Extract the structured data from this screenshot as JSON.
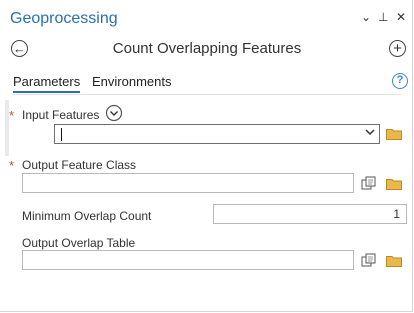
{
  "pane": {
    "title": "Geoprocessing",
    "controls": {
      "menu": "⌄",
      "pin": "⊥",
      "close": "✕"
    }
  },
  "tool": {
    "title": "Count Overlapping Features",
    "back_icon": "←",
    "add_icon": "+"
  },
  "tabs": [
    {
      "label": "Parameters",
      "active": true
    },
    {
      "label": "Environments",
      "active": false
    }
  ],
  "help_icon": "?",
  "params": {
    "input_features": {
      "label": "Input Features",
      "required": "*",
      "value": ""
    },
    "output_feature_class": {
      "label": "Output Feature Class",
      "required": "*",
      "value": ""
    },
    "min_overlap": {
      "label": "Minimum Overlap Count",
      "value": "1"
    },
    "output_overlap_table": {
      "label": "Output Overlap Table",
      "value": ""
    }
  },
  "colors": {
    "accent": "#2a6fb0",
    "required": "#d3492a",
    "folder": "#e8b84a"
  }
}
